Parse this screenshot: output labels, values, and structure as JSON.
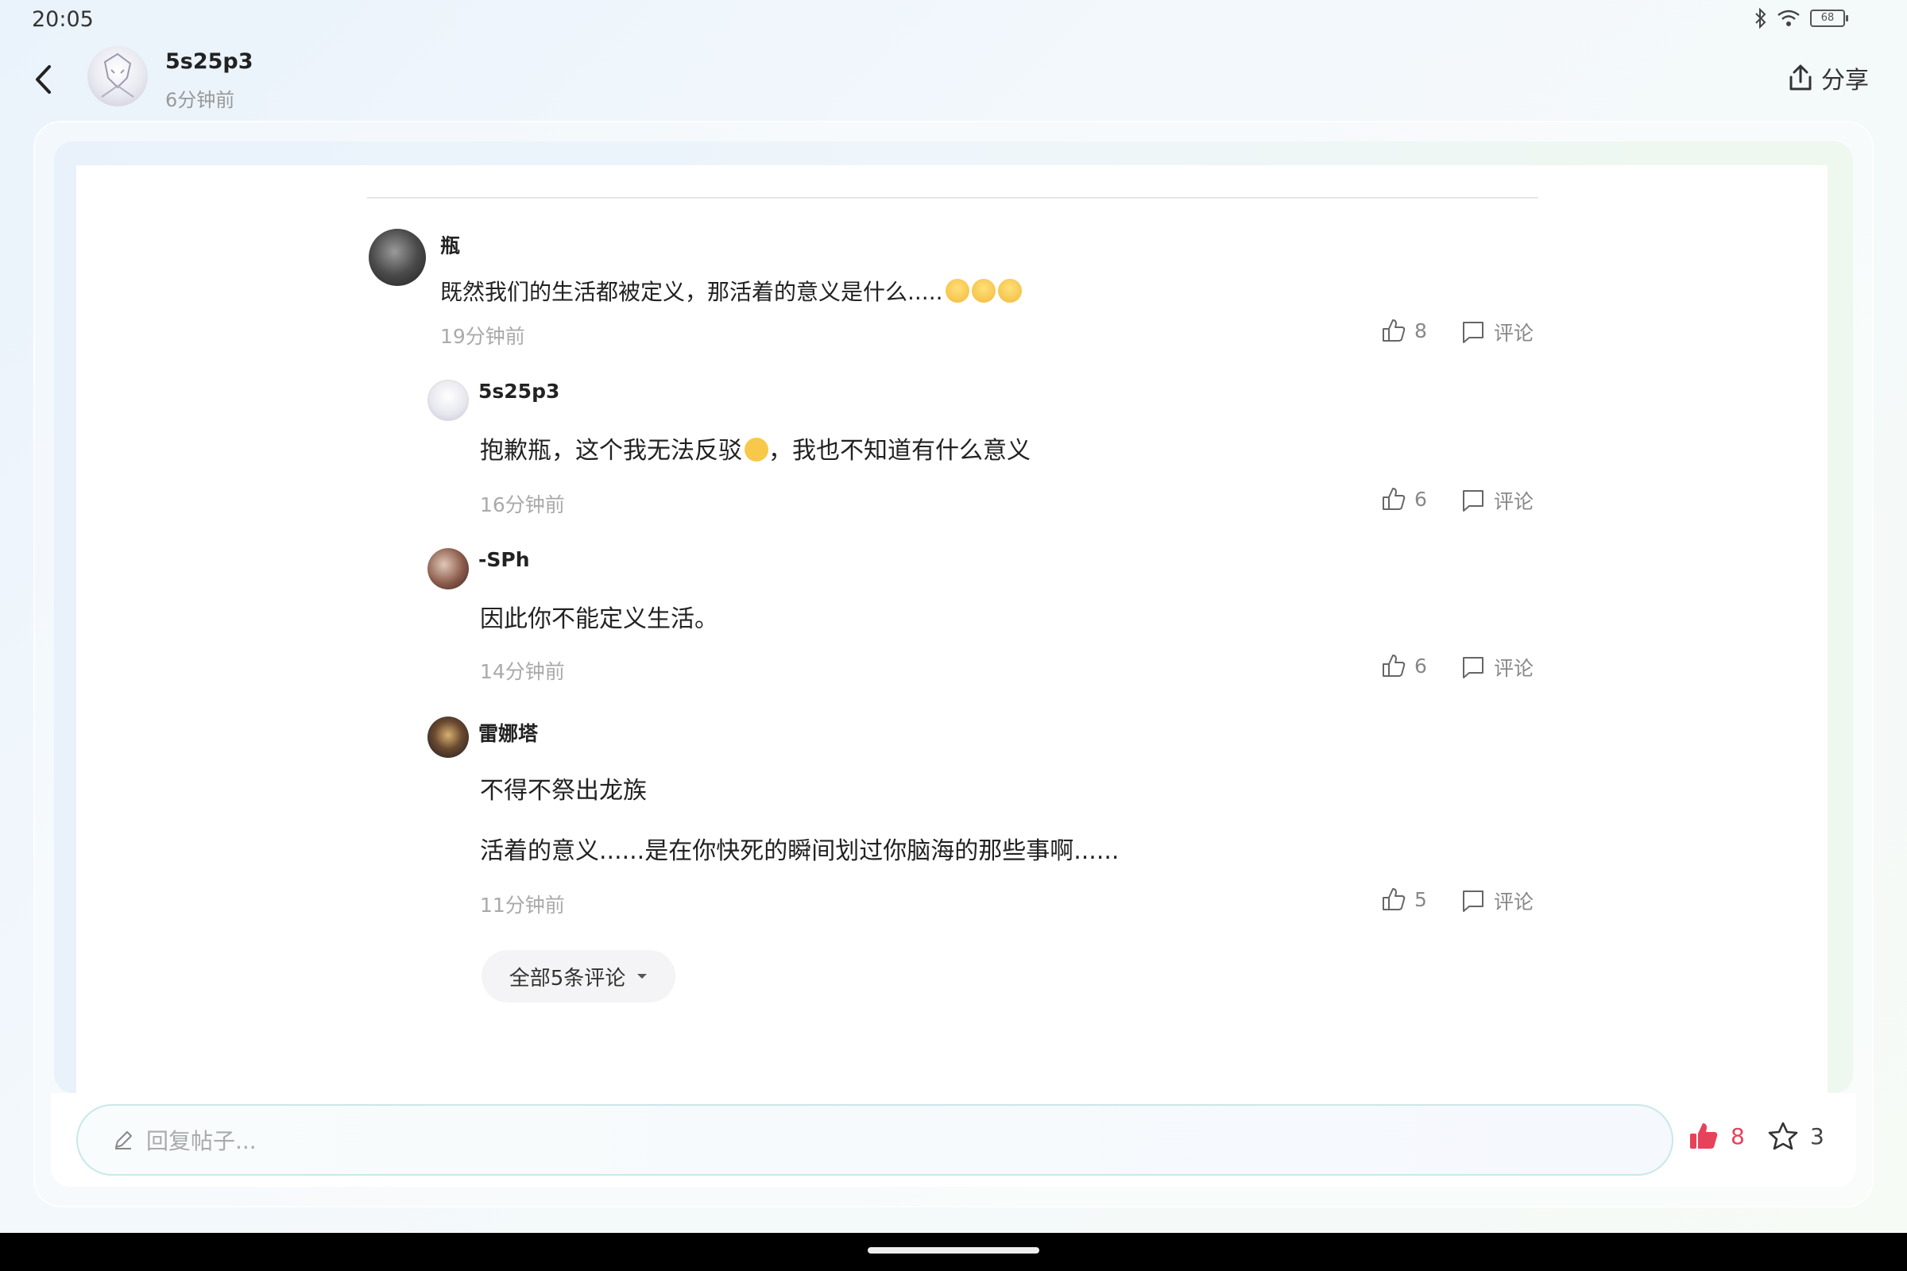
{
  "status_bar": {
    "time": "20:05",
    "battery": "68"
  },
  "header": {
    "username": "5s25p3",
    "post_time": "6分钟前",
    "share_label": "分享"
  },
  "comments": [
    {
      "name": "瓶",
      "text": "既然我们的生活都被定义，那活着的意义是什么.....",
      "time": "19分钟前",
      "likes": "8",
      "reply_label": "评论"
    },
    {
      "name": "5s25p3",
      "text_before": "抱歉瓶，这个我无法反驳",
      "text_after": "，我也不知道有什么意义",
      "time": "16分钟前",
      "likes": "6",
      "reply_label": "评论"
    },
    {
      "name": "-SPh",
      "text": "因此你不能定义生活。",
      "time": "14分钟前",
      "likes": "6",
      "reply_label": "评论"
    },
    {
      "name": "雷娜塔",
      "text_line1": "不得不祭出龙族",
      "text_line2": "活着的意义......是在你快死的瞬间划过你脑海的那些事啊......",
      "time": "11分钟前",
      "likes": "5",
      "reply_label": "评论"
    }
  ],
  "all_comments_label": "全部5条评论",
  "bottom_bar": {
    "reply_placeholder": "回复帖子...",
    "like_count": "8",
    "favorite_count": "3"
  },
  "colors": {
    "like_active": "#e8415a",
    "muted_text": "#aaaaaa",
    "input_border": "#c9e8ea"
  },
  "icons": [
    "back-arrow-icon",
    "share-icon",
    "thumbs-up-icon",
    "comment-bubble-icon",
    "chevron-down-icon",
    "pencil-icon",
    "star-icon",
    "bluetooth-icon",
    "wifi-icon",
    "battery-icon"
  ]
}
